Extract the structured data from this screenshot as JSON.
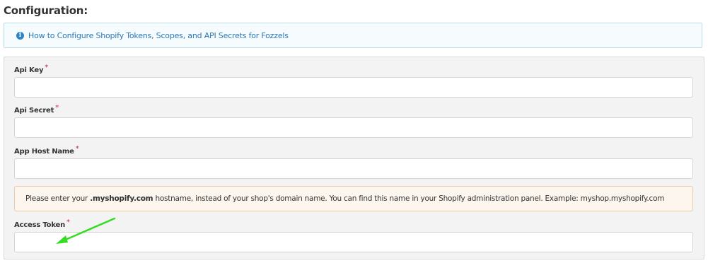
{
  "section": {
    "title": "Configuration:"
  },
  "info": {
    "icon": "info-icon",
    "link_text": "How to Configure Shopify Tokens, Scopes, and API Secrets for Fozzels"
  },
  "fields": {
    "api_key": {
      "label": "Api Key",
      "required_mark": "*",
      "value": ""
    },
    "api_secret": {
      "label": "Api Secret",
      "required_mark": "*",
      "value": ""
    },
    "app_host_name": {
      "label": "App Host Name",
      "required_mark": "*",
      "value": ""
    },
    "access_token": {
      "label": "Access Token",
      "required_mark": "*",
      "value": ""
    }
  },
  "hostname_notice": {
    "prefix": "Please enter your ",
    "highlight": ".myshopify.com",
    "suffix": " hostname, instead of your shop's domain name. You can find this name in your Shopify administration panel. Example: myshop.myshopify.com"
  },
  "colors": {
    "accent_link": "#2d78b5",
    "required": "#c7254e",
    "annotation_arrow": "#33dd22"
  }
}
